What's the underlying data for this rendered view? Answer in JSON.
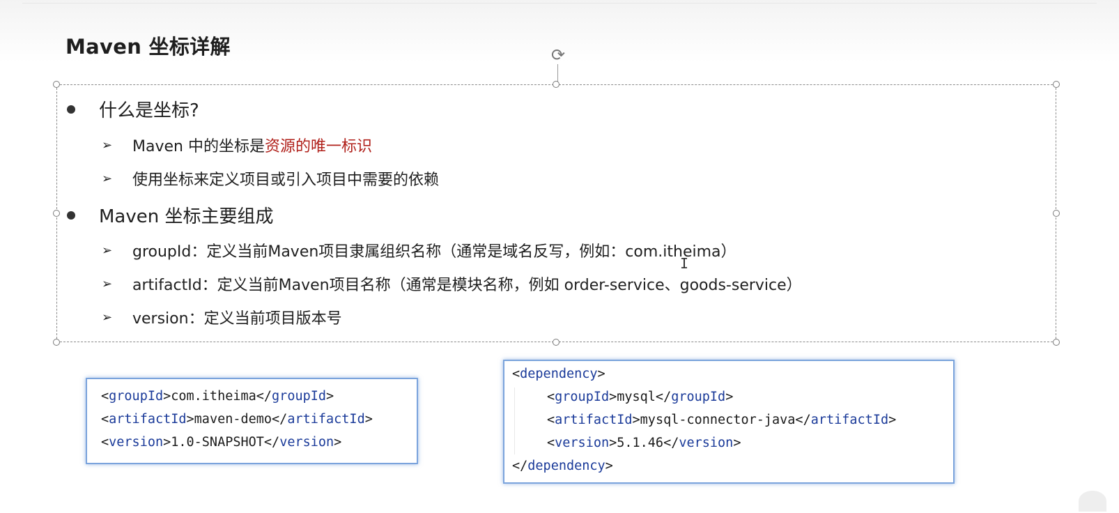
{
  "slide": {
    "title": "Maven 坐标详解",
    "sections": [
      {
        "heading": "什么是坐标?",
        "items": [
          {
            "prefix": "Maven 中的坐标是",
            "highlight": "资源的唯一标识"
          },
          {
            "text": "使用坐标来定义项目或引入项目中需要的依赖"
          }
        ]
      },
      {
        "heading": "Maven 坐标主要组成",
        "items": [
          {
            "text": "groupId：定义当前Maven项目隶属组织名称（通常是域名反写，例如：com.itheima）"
          },
          {
            "text": "artifactId：定义当前Maven项目名称（通常是模块名称，例如 order-service、goods-service）"
          },
          {
            "text": "version：定义当前项目版本号"
          }
        ]
      }
    ],
    "code_left": {
      "lines": [
        {
          "open": "<",
          "tag": "groupId",
          "mid": ">com.itheima</",
          "tag2": "groupId",
          "close": ">"
        },
        {
          "open": "<",
          "tag": "artifactId",
          "mid": ">maven-demo</",
          "tag2": "artifactId",
          "close": ">"
        },
        {
          "open": "<",
          "tag": "version",
          "mid": ">1.0-SNAPSHOT</",
          "tag2": "version",
          "close": ">"
        }
      ]
    },
    "code_right": {
      "lines": [
        {
          "open": "<",
          "tag": "dependency",
          "mid": ">",
          "tag2": "",
          "close": ""
        },
        {
          "open": "<",
          "tag": "groupId",
          "mid": ">mysql</",
          "tag2": "groupId",
          "close": ">"
        },
        {
          "open": "<",
          "tag": "artifactId",
          "mid": ">mysql-connector-java</",
          "tag2": "artifactId",
          "close": ">"
        },
        {
          "open": "<",
          "tag": "version",
          "mid": ">5.1.46</",
          "tag2": "version",
          "close": ">"
        },
        {
          "open": "</",
          "tag": "dependency",
          "mid": ">",
          "tag2": "",
          "close": ""
        }
      ]
    },
    "colors": {
      "highlight_red": "#b0201a",
      "code_tag_blue": "#1a3a99",
      "code_border": "#7aa3dc"
    },
    "icons": {
      "rotate": "rotate-handle-icon",
      "bullet": "filled-circle-bullet-icon",
      "sub_bullet": "arrow-bullet-icon",
      "cursor": "text-cursor-icon"
    }
  }
}
